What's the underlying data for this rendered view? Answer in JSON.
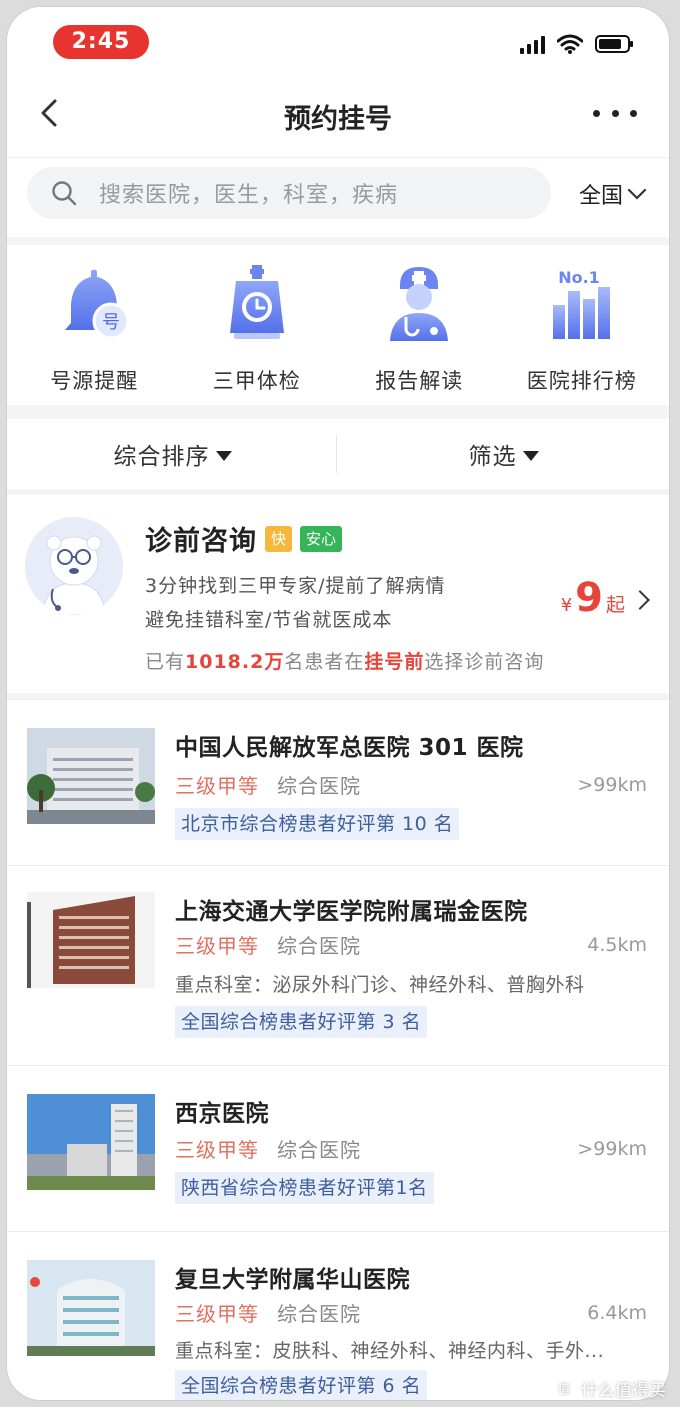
{
  "status_bar": {
    "time": "2:45",
    "signal_icon": "signal-icon",
    "wifi_icon": "wifi-icon",
    "battery_icon": "battery-icon"
  },
  "nav": {
    "title": "预约挂号",
    "back_icon": "back-chevron-icon",
    "more_icon": "more-dots-icon"
  },
  "search": {
    "placeholder": "搜索医院，医生，科室，疾病",
    "region": "全国"
  },
  "quick_entries": [
    {
      "label": "号源提醒",
      "icon": "bell-icon"
    },
    {
      "label": "三甲体检",
      "icon": "checkup-clipboard-icon"
    },
    {
      "label": "报告解读",
      "icon": "doctor-icon"
    },
    {
      "label": "医院排行榜",
      "icon": "ranking-chart-icon"
    }
  ],
  "sort_bar": {
    "sort_label": "综合排序",
    "filter_label": "筛选"
  },
  "consult": {
    "title": "诊前咨询",
    "tag_fast": "快",
    "tag_safe": "安心",
    "line1": "3分钟找到三甲专家/提前了解病情",
    "line2": "避免挂错科室/节省就医成本",
    "stat_prefix": "已有",
    "stat_count": "1018.2万",
    "stat_middle": "名患者在",
    "stat_highlight": "挂号前",
    "stat_suffix": "选择诊前咨询",
    "price_symbol": "¥",
    "price_value": "9",
    "price_suffix": "起"
  },
  "hospitals": [
    {
      "name": "中国人民解放军总医院 301 医院",
      "grade": "三级甲等",
      "kind": "综合医院",
      "distance": ">99km",
      "depts": "",
      "rank": "北京市综合榜患者好评第 10 名"
    },
    {
      "name": "上海交通大学医学院附属瑞金医院",
      "grade": "三级甲等",
      "kind": "综合医院",
      "distance": "4.5km",
      "depts": "重点科室：泌尿外科门诊、神经外科、普胸外科",
      "rank": "全国综合榜患者好评第 3 名"
    },
    {
      "name": "西京医院",
      "grade": "三级甲等",
      "kind": "综合医院",
      "distance": ">99km",
      "depts": "",
      "rank": "陕西省综合榜患者好评第1名"
    },
    {
      "name": "复旦大学附属华山医院",
      "grade": "三级甲等",
      "kind": "综合医院",
      "distance": "6.4km",
      "depts": "重点科室：皮肤科、神经外科、神经内科、手外...",
      "rank": "全国综合榜患者好评第 6 名"
    }
  ],
  "watermark": {
    "text": "什么值得买",
    "mark": "值"
  },
  "colors": {
    "accent_red": "#e8443a",
    "status_pill": "#e8342f",
    "tag_yellow": "#f6b73c",
    "tag_green": "#35b558",
    "rank_bg": "#eaf0fb",
    "rank_text": "#3f5e9c",
    "icon_blue": "#5b7cf0"
  }
}
